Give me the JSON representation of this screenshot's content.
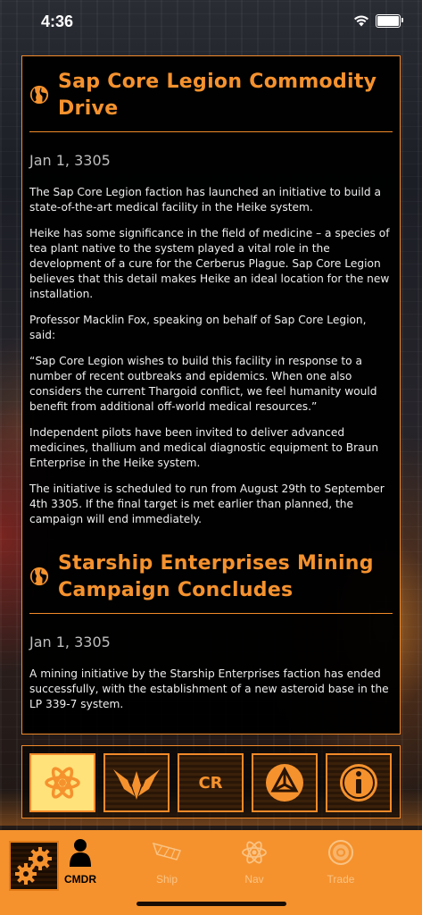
{
  "status_bar": {
    "time": "4:36"
  },
  "articles": [
    {
      "title": "Sap Core Legion Commodity Drive",
      "date": "Jan 1, 3305",
      "paragraphs": [
        "The Sap Core Legion faction has launched an initiative to build a state-of-the-art medical facility in the Heike system.",
        "Heike has some significance in the field of medicine – a species of tea plant native to the system played a vital role in the development of a cure for the Cerberus Plague. Sap Core Legion believes that this detail makes Heike an ideal location for the new installation.",
        "Professor Macklin Fox, speaking on behalf of Sap Core Legion, said:",
        "“Sap Core Legion wishes to build this facility in response to a number of recent outbreaks and epidemics. When one also considers the current Thargoid conflict, we feel humanity would benefit from additional off-world medical resources.”",
        "Independent pilots have been invited to deliver advanced medicines, thallium and medical diagnostic equipment to Braun Enterprise in the Heike system.",
        "The initiative is scheduled to run from August 29th to September 4th 3305. If the final target is met earlier than planned, the campaign will end immediately."
      ]
    },
    {
      "title": "Starship Enterprises Mining Campaign Concludes",
      "date": "Jan 1, 3305",
      "paragraphs": [
        "A mining initiative by the Starship Enterprises faction has ended successfully, with the establishment of a new asteroid base in the LP 339-7 system."
      ]
    }
  ],
  "tiles": [
    {
      "icon": "galnet-icon",
      "active": true
    },
    {
      "icon": "elite-rank-icon",
      "active": false
    },
    {
      "label": "CR",
      "icon": "credits-icon",
      "active": false
    },
    {
      "icon": "powerplay-icon",
      "active": false
    },
    {
      "icon": "info-icon",
      "active": false
    }
  ],
  "tab_bar": {
    "items": [
      {
        "label": "CMDR",
        "icon": "commander-icon",
        "active": true
      },
      {
        "label": "Ship",
        "icon": "ship-icon",
        "active": false
      },
      {
        "label": "Nav",
        "icon": "atom-icon",
        "active": false
      },
      {
        "label": "Trade",
        "icon": "trade-icon",
        "active": false
      }
    ]
  },
  "colors": {
    "accent": "#f5922e",
    "panel_bg": "#000000",
    "active_tile": "#ffe27a",
    "tab_bar_bg": "#f5922e"
  }
}
